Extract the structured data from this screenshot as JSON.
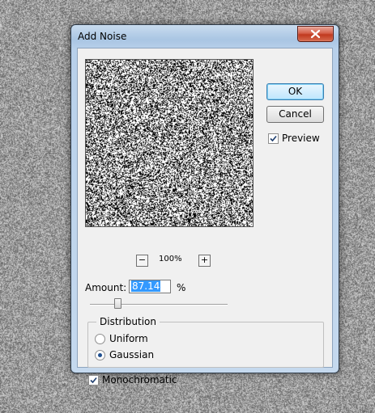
{
  "dialog": {
    "title": "Add Noise"
  },
  "buttons": {
    "ok": "OK",
    "cancel": "Cancel"
  },
  "preview": {
    "label": "Preview",
    "checked": true,
    "zoom": "100%",
    "zoom_out": "−",
    "zoom_in": "+"
  },
  "amount": {
    "label": "Amount:",
    "value": "87.14",
    "unit": "%",
    "slider_fraction": 0.2
  },
  "distribution": {
    "legend": "Distribution",
    "options": [
      {
        "label": "Uniform",
        "selected": false
      },
      {
        "label": "Gaussian",
        "selected": true
      }
    ]
  },
  "monochromatic": {
    "label": "Monochromatic",
    "checked": true
  },
  "icons": {
    "close": "close-icon",
    "check": "checkmark-icon"
  },
  "colors": {
    "selection": "#3399ff",
    "titlebar": "#b8d0ea",
    "close": "#c0391f"
  }
}
